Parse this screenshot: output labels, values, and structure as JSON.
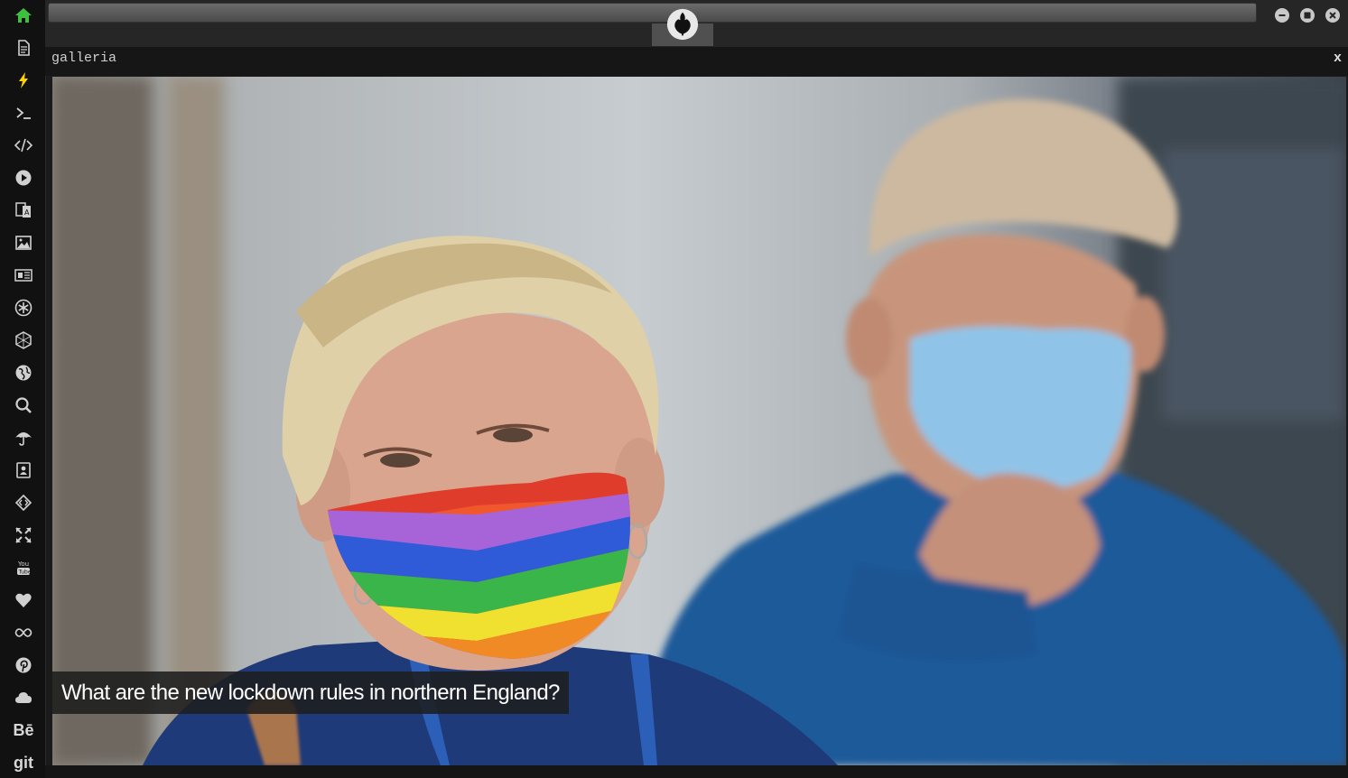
{
  "dock": {
    "items": [
      {
        "name": "home-icon",
        "color": "#3fbf3f"
      },
      {
        "name": "document-icon"
      },
      {
        "name": "lightning-icon",
        "color": "#ffd200"
      },
      {
        "name": "terminal-icon"
      },
      {
        "name": "code-icon"
      },
      {
        "name": "play-icon"
      },
      {
        "name": "translate-icon"
      },
      {
        "name": "image-icon"
      },
      {
        "name": "newspaper-icon"
      },
      {
        "name": "aperture-icon"
      },
      {
        "name": "hexagon-icon"
      },
      {
        "name": "globe-icon"
      },
      {
        "name": "search-icon"
      },
      {
        "name": "umbrella-icon"
      },
      {
        "name": "contact-book-icon"
      },
      {
        "name": "diamond-code-icon"
      },
      {
        "name": "expand-icon"
      },
      {
        "name": "youtube-icon"
      },
      {
        "name": "heart-icon"
      },
      {
        "name": "infinity-icon"
      },
      {
        "name": "pinterest-icon"
      },
      {
        "name": "cloud-icon"
      },
      {
        "name": "behance-icon",
        "text": "Bē"
      },
      {
        "name": "git-icon",
        "text": "git"
      }
    ]
  },
  "topbar": {
    "logo": "rebel-alliance-icon",
    "window_buttons": [
      "minimize-icon",
      "maximize-icon",
      "close-icon"
    ]
  },
  "window": {
    "title": "galleria",
    "close_label": "x"
  },
  "gallery": {
    "caption": "What are the new lockdown rules in northern England?"
  }
}
